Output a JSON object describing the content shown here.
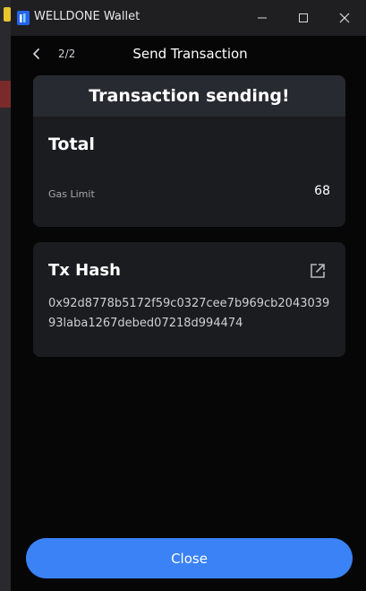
{
  "window": {
    "title": "WELLDONE Wallet"
  },
  "header": {
    "step": "2/2",
    "title": "Send Transaction"
  },
  "status_card": {
    "banner": "Transaction sending!",
    "total_label": "Total",
    "gas_limit_label": "Gas Limit",
    "gas_limit_value": "68"
  },
  "hash_card": {
    "label": "Tx Hash",
    "value": "0x92d8778b5172f59c0327cee7b969cb204303993laba1267debed07218d994474"
  },
  "footer": {
    "close_label": "Close"
  },
  "colors": {
    "accent": "#3b82f6",
    "card": "#1b1c1f",
    "background": "#060607"
  },
  "icons": [
    "welldone-app-icon",
    "minimize-icon",
    "maximize-icon",
    "close-icon",
    "chevron-left-icon",
    "external-link-icon"
  ]
}
